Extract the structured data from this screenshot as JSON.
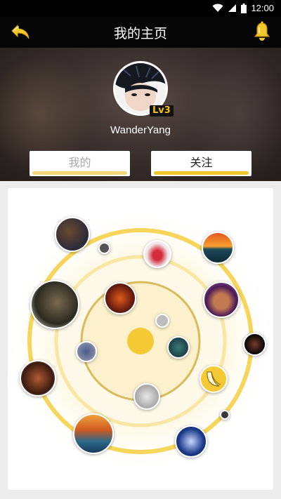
{
  "status": {
    "time": "12:00"
  },
  "app_bar": {
    "title": "我的主页"
  },
  "profile": {
    "username": "WanderYang",
    "level": "Lv3"
  },
  "tabs": [
    {
      "label": "我的"
    },
    {
      "label": "关注"
    }
  ],
  "colors": {
    "accent": "#f3c62b",
    "ring_light": "#fbe9a8",
    "core": "#f5c933"
  },
  "bubbles": [
    {
      "name": "bubble-forest-room",
      "icon": "forest-room-photo"
    },
    {
      "name": "bubble-tiny-dot-1",
      "icon": "small-avatar"
    },
    {
      "name": "bubble-red-lips",
      "icon": "red-lips-photo"
    },
    {
      "name": "bubble-sunset-sea",
      "icon": "sunset-sea-photo"
    },
    {
      "name": "bubble-dreadlocks-man",
      "icon": "dreadlocks-portrait"
    },
    {
      "name": "bubble-fire-glow",
      "icon": "fire-glow-photo"
    },
    {
      "name": "bubble-curly-girl",
      "icon": "curly-hair-portrait"
    },
    {
      "name": "bubble-small-figure",
      "icon": "small-figure-photo"
    },
    {
      "name": "bubble-teal-portrait",
      "icon": "teal-portrait"
    },
    {
      "name": "bubble-dark-face",
      "icon": "dark-face-portrait"
    },
    {
      "name": "bubble-blue-figure",
      "icon": "blue-figure-photo"
    },
    {
      "name": "bubble-banana",
      "icon": "banana-icon"
    },
    {
      "name": "bubble-guitar-man",
      "icon": "guitar-player-photo"
    },
    {
      "name": "bubble-sketch",
      "icon": "sketch-drawing"
    },
    {
      "name": "bubble-tiny-dot-2",
      "icon": "small-avatar"
    },
    {
      "name": "bubble-sailing-ships",
      "icon": "sailing-ships-painting"
    },
    {
      "name": "bubble-blue-hands",
      "icon": "blue-hands-photo"
    }
  ]
}
